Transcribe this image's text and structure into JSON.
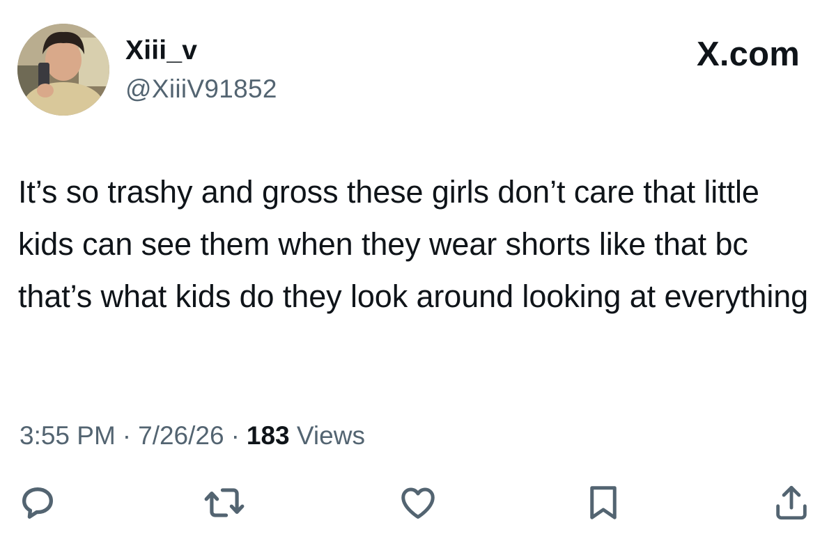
{
  "author": {
    "display_name": "Xiii_v",
    "handle": "@XiiiV91852",
    "avatar": "profile-photo"
  },
  "brand": "X.com",
  "tweet": {
    "text": "It’s so trashy and gross these girls don’t care that little kids can see them when they wear shorts like that bc that’s what kids do they look around looking at everything",
    "time": "3:55 PM",
    "date": "7/26/26",
    "separator": "·",
    "views_count": "183",
    "views_label": "Views"
  },
  "actions": [
    {
      "name": "reply",
      "icon": "reply-icon"
    },
    {
      "name": "retweet",
      "icon": "retweet-icon"
    },
    {
      "name": "like",
      "icon": "heart-icon"
    },
    {
      "name": "bookmark",
      "icon": "bookmark-icon"
    },
    {
      "name": "share",
      "icon": "share-icon"
    }
  ],
  "colors": {
    "text": "#0f1419",
    "secondary": "#536471",
    "icon": "#536471",
    "background": "#ffffff"
  }
}
